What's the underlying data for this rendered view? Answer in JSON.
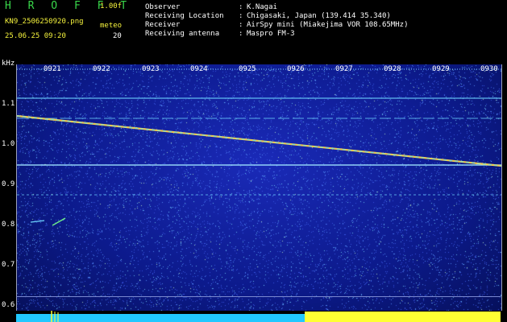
{
  "header": {
    "app_title": "H R O F F T",
    "version": "1.00f",
    "file_name": "KN9_2506250920.png",
    "datetime": "25.06.25 09:20",
    "meteo_label": "meteo",
    "meteo_count": "20"
  },
  "info": [
    {
      "label": "Observer",
      "value": "K.Nagai"
    },
    {
      "label": "Receiving Location",
      "value": "Chigasaki, Japan (139.414 35.340)"
    },
    {
      "label": "Receiver",
      "value": "AirSpy mini (Miakejima VOR 108.65MHz)"
    },
    {
      "label": "Receiving antenna",
      "value": "Maspro FM-3"
    }
  ],
  "spectrogram": {
    "unit_label": "kHz",
    "y_ticks": [
      "1.1",
      "1.0",
      "0.9",
      "0.8",
      "0.7",
      "0.6"
    ],
    "y_values": [
      1.1,
      1.0,
      0.9,
      0.8,
      0.7,
      0.6
    ],
    "time_ticks": [
      "0921",
      "0922",
      "0923",
      "0924",
      "0925",
      "0926",
      "0927",
      "0928",
      "0929",
      "0930"
    ],
    "colors": {
      "background": "#0c1a8c",
      "carrier": "#8fe6ff",
      "trail": "#ffd24a",
      "cyan_bar": "#21c8ff",
      "yellow_bar": "#ffff33"
    }
  }
}
